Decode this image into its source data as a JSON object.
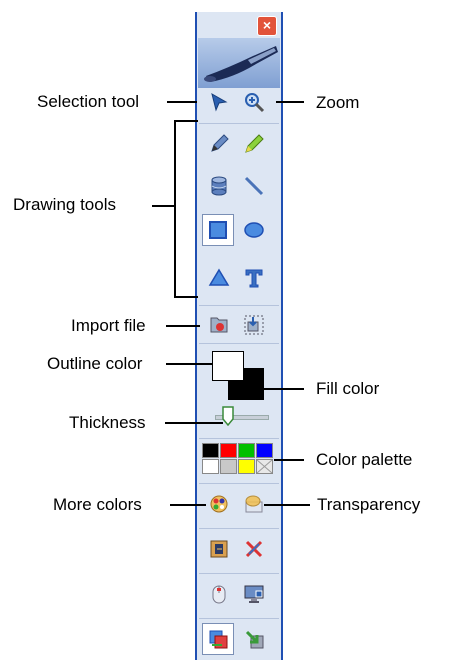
{
  "labels": {
    "selection_tool": "Selection tool",
    "zoom": "Zoom",
    "drawing_tools": "Drawing tools",
    "import_file": "Import file",
    "outline_color": "Outline color",
    "fill_color": "Fill color",
    "thickness": "Thickness",
    "color_palette": "Color palette",
    "more_colors": "More colors",
    "transparency": "Transparency"
  },
  "close_glyph": "×",
  "palette": [
    "#000000",
    "#ff0000",
    "#00c000",
    "#0000ff",
    "#ffffff",
    "#c8c8c8",
    "#ffff00",
    "none"
  ],
  "outline_color_value": "#ffffff",
  "fill_color_value": "#000000",
  "icons": [
    "pointer-icon",
    "zoom-icon",
    "pencil-icon",
    "highlighter-icon",
    "cylinder-icon",
    "line-icon",
    "rectangle-icon",
    "ellipse-icon",
    "triangle-icon",
    "text-icon",
    "import-file-icon",
    "capture-icon",
    "more-colors-icon",
    "transparency-icon"
  ]
}
